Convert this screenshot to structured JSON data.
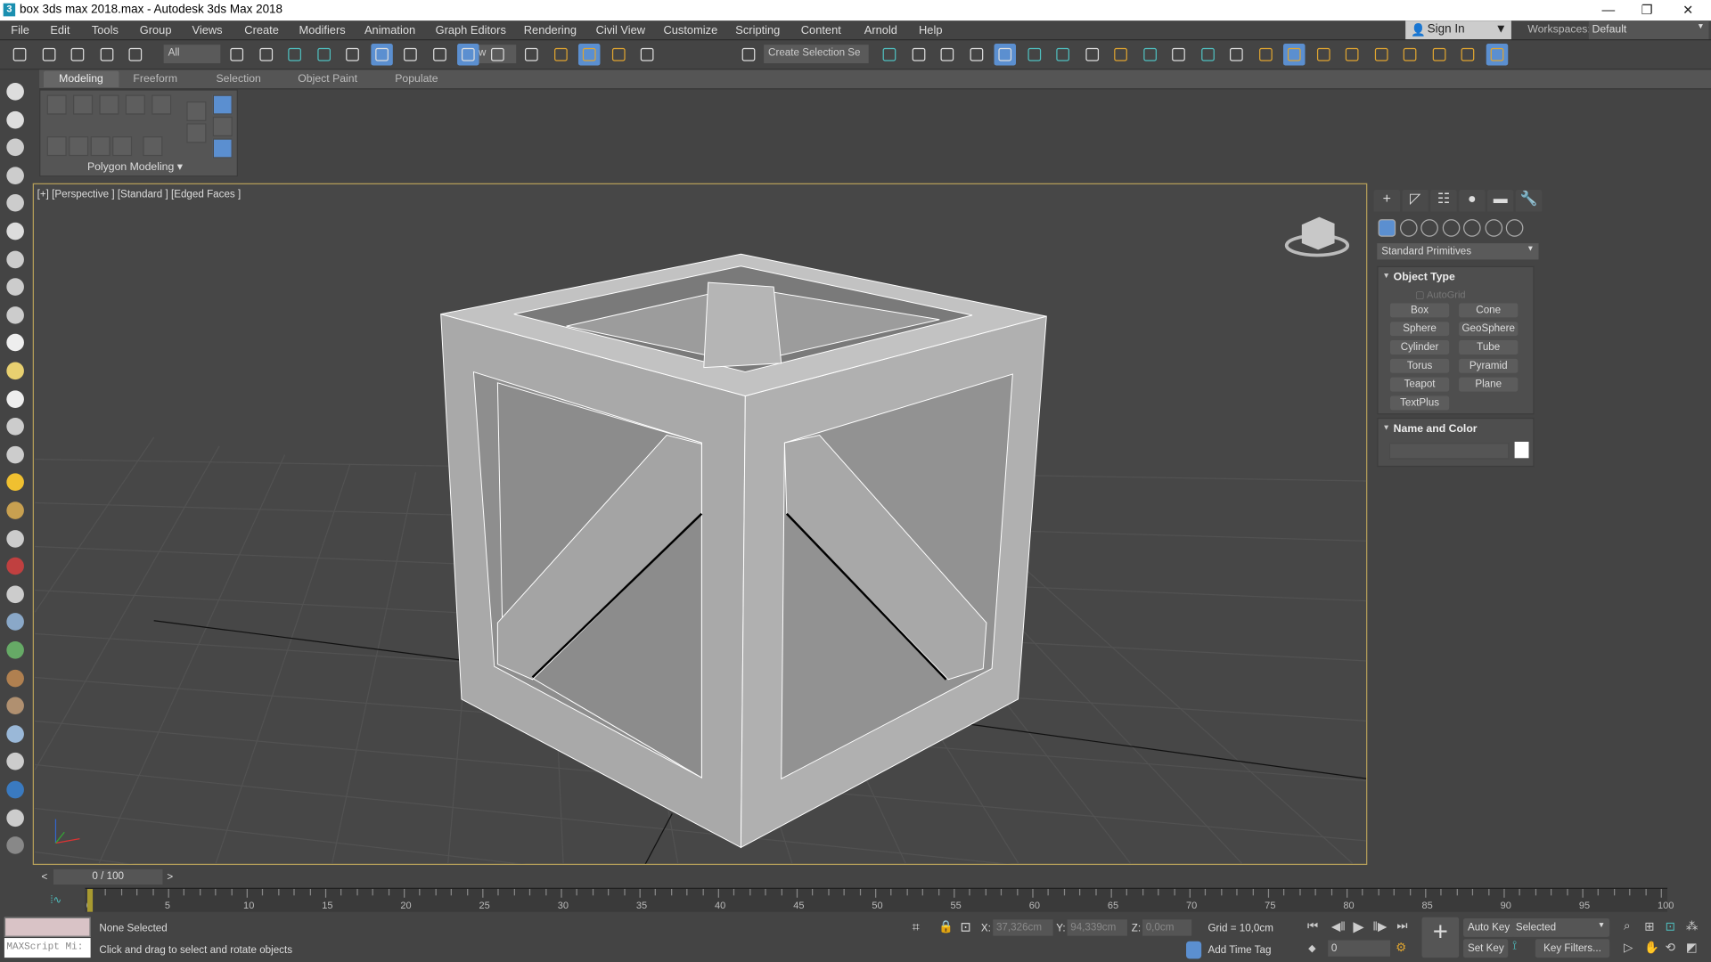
{
  "window": {
    "title": "box 3ds max 2018.max - Autodesk 3ds Max 2018",
    "logo": "3",
    "minimize": "—",
    "restore": "❐",
    "close": "✕"
  },
  "menu": [
    "File",
    "Edit",
    "Tools",
    "Group",
    "Views",
    "Create",
    "Modifiers",
    "Animation",
    "Graph Editors",
    "Rendering",
    "Civil View",
    "Customize",
    "Scripting",
    "Content",
    "Arnold",
    "Help"
  ],
  "account": {
    "sign_in": "Sign In",
    "workspaces_label": "Workspaces:",
    "workspace": "Default"
  },
  "toolbar": {
    "selection_filter": "All",
    "ref_coord": "View",
    "selection_set": "Create Selection Se",
    "icons": [
      "undo-icon",
      "redo-icon",
      "link-icon",
      "unlink-icon",
      "bind-space-warp-icon",
      "select-object-icon",
      "select-by-name-icon",
      "rect-selection-region-icon",
      "window-crossing-icon",
      "select-move-icon",
      "select-rotate-icon",
      "select-scale-icon",
      "select-place-icon",
      "use-pivot-icon",
      "select-manipulate-icon",
      "keyboard-shortcut-icon",
      "snaps-toggle-icon",
      "angle-snap-icon",
      "percent-snap-icon",
      "spinner-snap-icon",
      "edit-named-selection-icon",
      "mirror-icon",
      "align-icon",
      "scene-explorer-icon",
      "layer-explorer-icon",
      "ribbon-toggle-icon",
      "curve-editor-icon",
      "schematic-view-icon",
      "material-editor-icon",
      "render-setup-icon",
      "rendered-frame-window-icon",
      "render-production-icon",
      "render-cloud-icon",
      "arnold-icon",
      "snap-grid-icon",
      "snap-pivot-icon",
      "snap-bbox-icon",
      "snap-edge-icon",
      "snap-face-icon",
      "snap-vertex-icon",
      "snap-perp-icon",
      "snap-freeze-icon",
      "snap-axis-constraint-icon"
    ],
    "active": [
      "select-rotate-icon",
      "use-pivot-icon",
      "angle-snap-icon",
      "ribbon-toggle-icon",
      "snap-pivot-icon",
      "snap-axis-constraint-icon"
    ]
  },
  "ribbon": {
    "tabs": [
      "Modeling",
      "Freeform",
      "Selection",
      "Object Paint",
      "Populate"
    ],
    "active_tab": "Modeling",
    "panel_label": "Polygon Modeling ▾"
  },
  "left_toolbar": [
    "teapot-icon",
    "cloud-icon",
    "media-icon",
    "list-icon",
    "grid-icon",
    "light-bulb-icon",
    "move-tool-icon",
    "spring-icon",
    "camera-icon",
    "plane-icon",
    "dome-icon",
    "sphere-icon",
    "hair-icon",
    "cone-icon",
    "sun-icon",
    "ball-icon",
    "cloth-icon",
    "bone-icon",
    "physique-icon",
    "sphere-blue-icon",
    "grass-icon",
    "hair-fx-icon",
    "ox-icon",
    "glass-sphere-icon",
    "container-icon",
    "world-icon",
    "layers-icon",
    "help-icon"
  ],
  "viewport": {
    "label": "[+] [Perspective ] [Standard ] [Edged Faces ]",
    "colors": {
      "face_light": "#b2b2b2",
      "face_mid": "#8e8e8e",
      "face_dark": "#6e6e6e",
      "background": "#474747",
      "border": "#b8a15a"
    }
  },
  "command_panel": {
    "tabs": [
      {
        "icon": "create-icon",
        "glyph": "+"
      },
      {
        "icon": "modify-icon",
        "glyph": "◸"
      },
      {
        "icon": "hierarchy-icon",
        "glyph": "☷"
      },
      {
        "icon": "motion-icon",
        "glyph": "●"
      },
      {
        "icon": "display-icon",
        "glyph": "▬"
      },
      {
        "icon": "utilities-icon",
        "glyph": "🔧"
      }
    ],
    "subtypes": [
      "geometry-icon",
      "shapes-icon",
      "lights-icon",
      "cameras-icon",
      "helpers-icon",
      "space-warps-icon",
      "systems-icon"
    ],
    "category": "Standard Primitives",
    "object_type": {
      "title": "Object Type",
      "autogrid": "AutoGrid",
      "buttons": [
        "Box",
        "Cone",
        "Sphere",
        "GeoSphere",
        "Cylinder",
        "Tube",
        "Torus",
        "Pyramid",
        "Teapot",
        "Plane",
        "TextPlus"
      ]
    },
    "name_color": {
      "title": "Name and Color",
      "name_value": "",
      "color": "#ffffff"
    }
  },
  "timeline": {
    "frame_display": "0 / 100",
    "current_frame": 0,
    "start": 0,
    "end": 100,
    "labels": [
      "0",
      "5",
      "10",
      "15",
      "20",
      "25",
      "30",
      "35",
      "40",
      "45",
      "50",
      "55",
      "60",
      "65",
      "70",
      "75",
      "80",
      "85",
      "90",
      "95",
      "100"
    ],
    "prev": "<",
    "next": ">"
  },
  "status": {
    "maxscript_placeholder": "MAXScript Mi:",
    "selection": "None Selected",
    "prompt": "Click and drag to select and rotate objects",
    "x_label": "X:",
    "x": "37,326cm",
    "y_label": "Y:",
    "y": "94,339cm",
    "z_label": "Z:",
    "z": "0,0cm",
    "grid": "Grid = 10,0cm",
    "add_time_tag": "Add Time Tag",
    "frame_spinner": "0",
    "auto_key": "Auto Key",
    "set_key": "Set Key",
    "key_mode": "Selected",
    "key_filters": "Key Filters..."
  }
}
